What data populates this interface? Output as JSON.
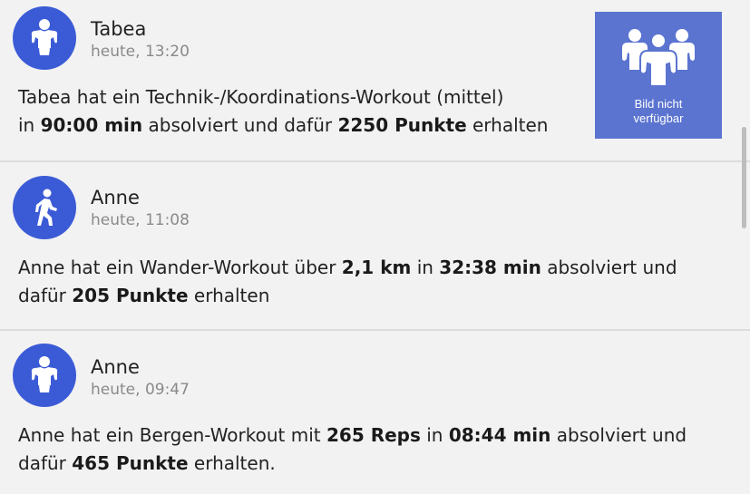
{
  "colors": {
    "avatar_bg": "#3b5bd6",
    "thumbnail_bg": "#5b74d0",
    "card_bg": "#f2f2f2"
  },
  "feed": [
    {
      "user": "Tabea",
      "time": "heute, 13:20",
      "avatar_icon": "bodybuilder-icon",
      "line1": {
        "t1": "Tabea hat ein Technik-/Koordinations-Workout (mittel)"
      },
      "line2": {
        "t1": "in ",
        "b1": "90:00 min",
        "t2": " absolviert und dafür ",
        "b2": "2250 Punkte",
        "t3": " erhalten"
      },
      "thumbnail": {
        "icon": "group-of-athletes-icon",
        "text_line1": "Bild nicht",
        "text_line2": "verfügbar"
      }
    },
    {
      "user": "Anne",
      "time": "heute, 11:08",
      "avatar_icon": "hiker-icon",
      "line1": {
        "t1": "Anne  hat ein Wander-Workout über ",
        "b1": "2,1 km",
        "t2": " in ",
        "b2": "32:38 min",
        "t3": " absolviert und"
      },
      "line2": {
        "t1": "dafür ",
        "b1": "205 Punkte",
        "t2": " erhalten"
      }
    },
    {
      "user": "Anne",
      "time": "heute, 09:47",
      "avatar_icon": "bodybuilder-icon",
      "line1": {
        "t1": "Anne  hat ein Bergen-Workout mit ",
        "b1": "265 Reps",
        "t2": " in ",
        "b2": "08:44 min",
        "t3": " absolviert und"
      },
      "line2": {
        "t1": "dafür ",
        "b1": "465 Punkte",
        "t2": " erhalten."
      }
    }
  ]
}
